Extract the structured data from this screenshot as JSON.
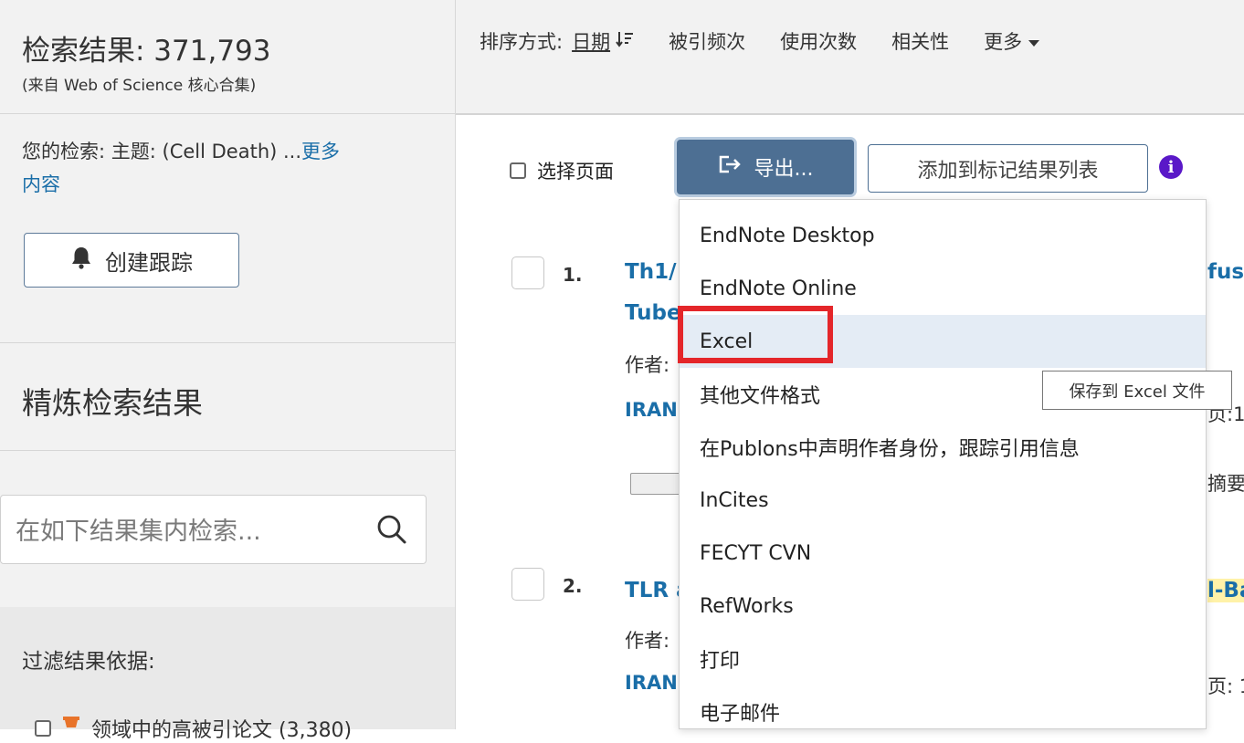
{
  "sidebar": {
    "results_title": "检索结果: 371,793",
    "results_source": "(来自 Web of Science 核心合集)",
    "query_prefix": "您的检索: 主题: (Cell Death) ...",
    "query_more_1": "更多",
    "query_more_2": "内容",
    "create_alert_label": "创建跟踪",
    "refine_title": "精炼检索结果",
    "search_within_placeholder": "在如下结果集内检索...",
    "filter_title": "过滤结果依据:",
    "filter_item_label": "领域中的高被引论文 (3,380)"
  },
  "sortbar": {
    "label": "排序方式:",
    "options": [
      "日期",
      "被引频次",
      "使用次数",
      "相关性",
      "更多"
    ]
  },
  "toolbar": {
    "select_page_label": "选择页面",
    "export_label": "导出...",
    "add_marked_label": "添加到标记结果列表",
    "info_glyph": "i"
  },
  "records": [
    {
      "number": "1.",
      "title_start": "Th1/",
      "title_line2": "Tube",
      "title_end": "fusi",
      "authors_prefix": "作者:",
      "source_prefix": "IRAN",
      "right_fragment_1": "页:1",
      "right_fragment_2": "摘要"
    },
    {
      "number": "2.",
      "title_start": "TLR a",
      "title_end": "l-Ba",
      "authors_prefix": "作者:",
      "source_prefix": "IRAN",
      "right_fragment_1": "页: 1"
    }
  ],
  "export_menu": {
    "items": [
      "EndNote Desktop",
      "EndNote Online",
      "Excel",
      "其他文件格式",
      "在Publons中声明作者身份，跟踪引用信息",
      "InCites",
      "FECYT CVN",
      "RefWorks",
      "打印",
      "电子邮件"
    ],
    "hovered_item": "Excel",
    "tooltip": "保存到 Excel 文件"
  },
  "colors": {
    "accent_button": "#4d6f93",
    "link": "#1a6ea8",
    "highlight_box": "#e4262a",
    "info_icon": "#5a18c8"
  }
}
